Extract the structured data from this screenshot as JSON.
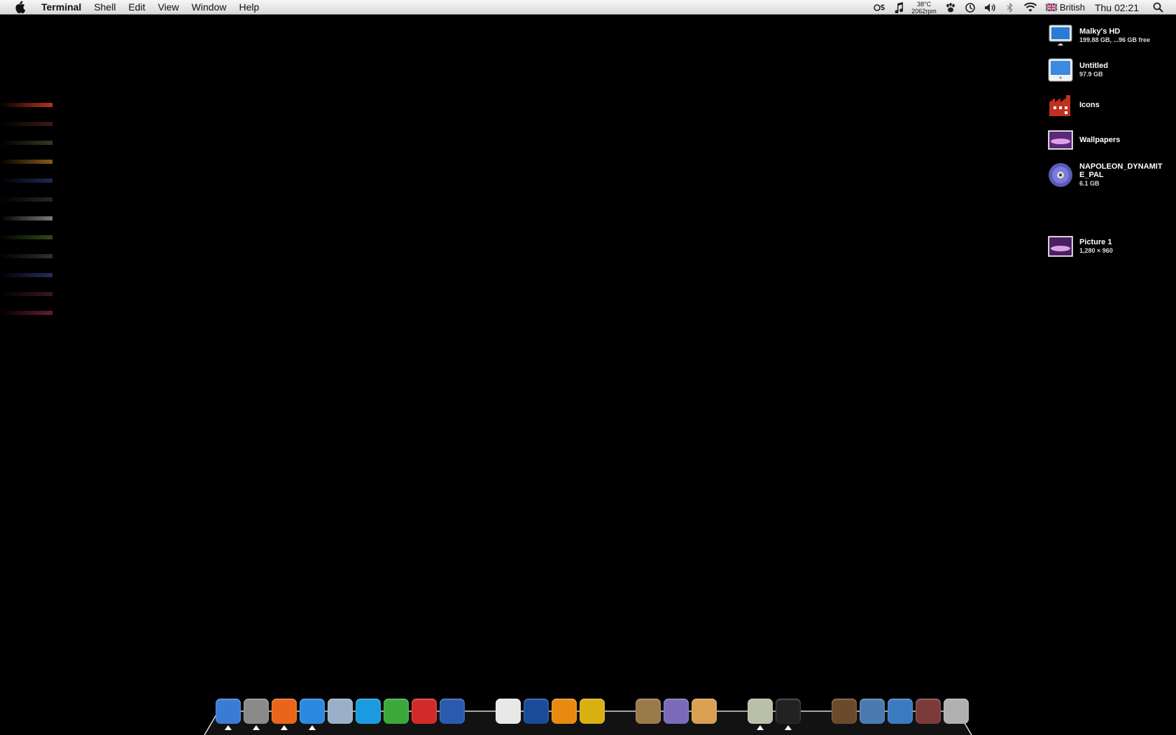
{
  "menubar": {
    "apple": "apple-menu-icon",
    "app_name": "Terminal",
    "menus": [
      "Shell",
      "Edit",
      "View",
      "Window",
      "Help"
    ],
    "status": {
      "temperature": "38°C",
      "fan": "2062rpm",
      "language": "British",
      "clock": "Thu 02:21"
    }
  },
  "desktop": {
    "background": "#000000",
    "stripes": [
      "#b8351b",
      "#3a1a14",
      "#36381f",
      "#8a5a1a",
      "#1a2a55",
      "#2a232b",
      "#7a7a7a",
      "#2f4a18",
      "#303035",
      "#2a2a60",
      "#3a1620",
      "#6a1a30"
    ],
    "icons": [
      {
        "name": "Malky's HD",
        "sub": "199.88 GB, ...96 GB free",
        "icon": "hard-drive-icon"
      },
      {
        "name": "Untitled",
        "sub": "97.9 GB",
        "icon": "external-drive-icon"
      },
      {
        "name": "Icons",
        "sub": "",
        "icon": "factory-folder-icon"
      },
      {
        "name": "Wallpapers",
        "sub": "",
        "icon": "wallpaper-image-icon"
      },
      {
        "name": "NAPOLEON_DYNAMITE_PAL",
        "sub": "6.1 GB",
        "icon": "dvd-icon"
      },
      {
        "name": "Picture 1",
        "sub": "1,280 × 960",
        "icon": "picture-icon"
      }
    ]
  },
  "dock": {
    "items": [
      {
        "name": "finder-icon",
        "color": "#3a7bd5",
        "running": true
      },
      {
        "name": "system-preferences-icon",
        "color": "#8a8a8a",
        "running": true
      },
      {
        "name": "firefox-icon",
        "color": "#e8661a",
        "running": true
      },
      {
        "name": "safari-icon",
        "color": "#2a8ae0",
        "running": true
      },
      {
        "name": "itunes-icon",
        "color": "#9ab0c8",
        "running": false
      },
      {
        "name": "quicktime-icon",
        "color": "#1a9ae0",
        "running": false
      },
      {
        "name": "adium-icon",
        "color": "#3aa83a",
        "running": false
      },
      {
        "name": "c-app-icon",
        "color": "#d22a2a",
        "running": false
      },
      {
        "name": "google-earth-icon",
        "color": "#2a5ab0",
        "running": false
      },
      {
        "name": "acrobat-icon",
        "color": "#e8e8e8",
        "running": false
      },
      {
        "name": "photoshop-icon",
        "color": "#1a4a9a",
        "running": false
      },
      {
        "name": "illustrator-icon",
        "color": "#e88a10",
        "running": false
      },
      {
        "name": "fireworks-icon",
        "color": "#d8b010",
        "running": false
      },
      {
        "name": "preview-photo-icon",
        "color": "#9a7a4a",
        "running": false
      },
      {
        "name": "potion-app-icon",
        "color": "#7a6ab8",
        "running": false
      },
      {
        "name": "sign-app-icon",
        "color": "#d8a050",
        "running": false
      },
      {
        "name": "ipod-icon",
        "color": "#b8c0a8",
        "running": true
      },
      {
        "name": "terminal-icon",
        "color": "#222222",
        "running": true
      },
      {
        "name": "mail-stack-icon",
        "color": "#6a4a2a",
        "running": false
      },
      {
        "name": "folder-stack-icon",
        "color": "#4a7ab0",
        "running": false
      },
      {
        "name": "applications-stack-icon",
        "color": "#3a7ac0",
        "running": false
      },
      {
        "name": "pictures-stack-icon",
        "color": "#7a3a3a",
        "running": false
      },
      {
        "name": "trash-icon",
        "color": "#b0b0b0",
        "running": false
      }
    ]
  }
}
